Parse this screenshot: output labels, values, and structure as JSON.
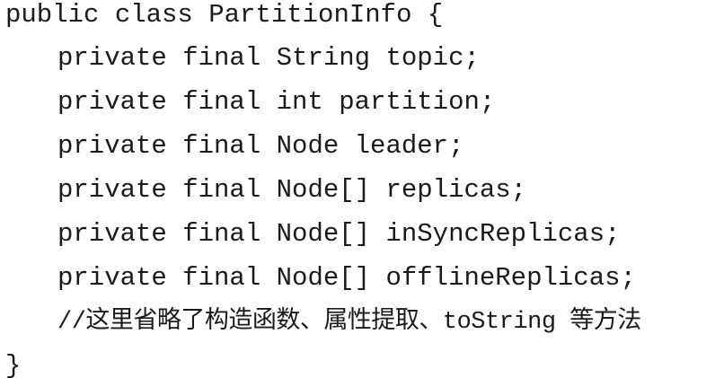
{
  "code": {
    "lines": [
      "public class PartitionInfo {",
      "private final String topic;",
      "private final int partition;",
      "private final Node leader;",
      "private final Node[] replicas;",
      "private final Node[] inSyncReplicas;",
      "private final Node[] offlineReplicas;",
      "//这里省略了构造函数、属性提取、toString 等方法",
      "}"
    ]
  }
}
